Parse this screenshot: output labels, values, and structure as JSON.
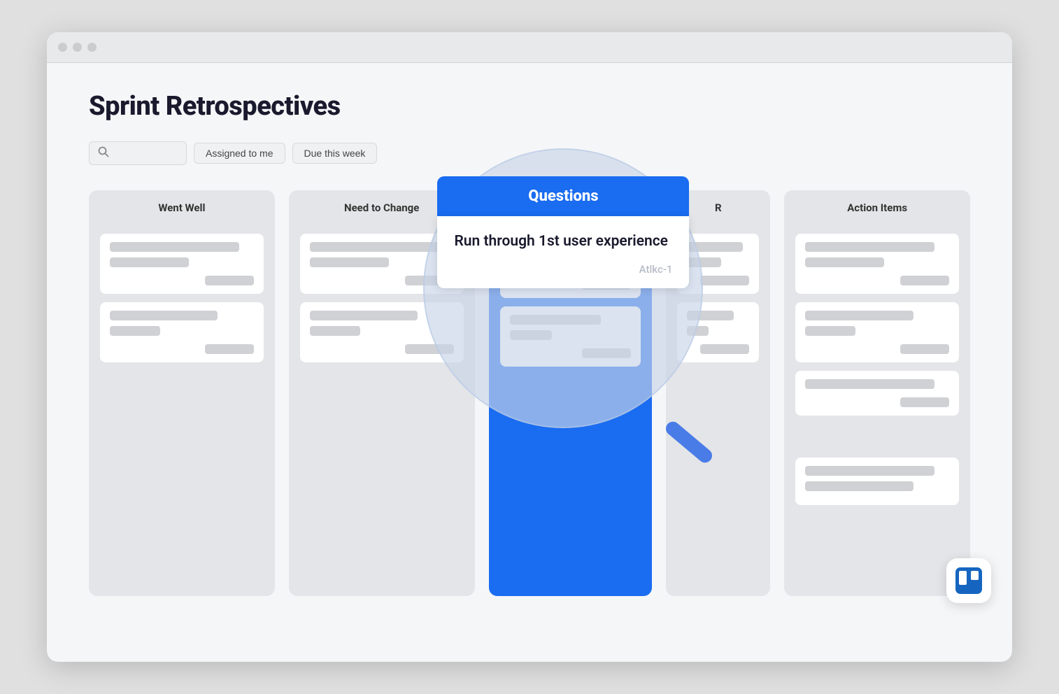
{
  "browser": {
    "dots": [
      "dot1",
      "dot2",
      "dot3"
    ]
  },
  "page": {
    "title": "Sprint Retrospectives"
  },
  "filters": {
    "search_placeholder": "Search...",
    "assigned_label": "Assigned to me",
    "due_label": "Due this week"
  },
  "columns": [
    {
      "id": "went-well",
      "header": "Went Well",
      "cards": [
        {
          "bars": [
            "long",
            "short"
          ],
          "has_tag": true
        },
        {
          "bars": [
            "medium",
            "xshort"
          ],
          "has_tag": true
        }
      ]
    },
    {
      "id": "need-to-change",
      "header": "Need to Change",
      "cards": [
        {
          "bars": [
            "long",
            "short"
          ],
          "has_tag": true
        },
        {
          "bars": [
            "medium",
            "xshort"
          ],
          "has_tag": true
        }
      ]
    },
    {
      "id": "questions",
      "header": "Questions",
      "highlighted": true,
      "cards": [
        {
          "bars": [
            "long",
            "short"
          ],
          "has_tag": true
        },
        {
          "bars": [
            "medium",
            "xshort"
          ],
          "has_tag": true
        }
      ]
    },
    {
      "id": "partial",
      "header": "R",
      "partial": true,
      "cards": [
        {
          "bars": [
            "long",
            "short"
          ],
          "has_tag": true
        }
      ]
    },
    {
      "id": "action-items",
      "header": "Action Items",
      "cards": [
        {
          "bars": [
            "long",
            "short"
          ],
          "has_tag": true
        },
        {
          "bars": [
            "medium",
            "xshort"
          ],
          "has_tag": true
        },
        {
          "bars": [
            "long"
          ],
          "has_tag": true
        }
      ]
    }
  ],
  "zoomed_card": {
    "column_title": "Questions",
    "card_title": "Run through 1st user experience",
    "card_id": "Atlkc-1"
  },
  "trello": {
    "logo_label": "Trello"
  }
}
